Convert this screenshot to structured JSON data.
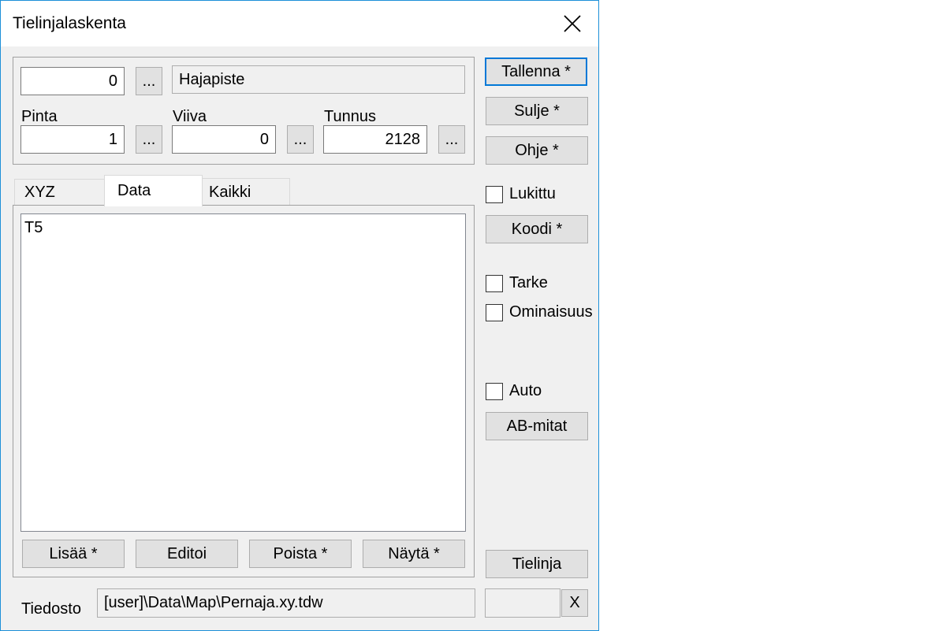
{
  "window": {
    "title": "Tielinjalaskenta"
  },
  "top_group": {
    "point_number": "0",
    "point_type": "Hajapiste",
    "pinta_label": "Pinta",
    "pinta_value": "1",
    "viiva_label": "Viiva",
    "viiva_value": "0",
    "tunnus_label": "Tunnus",
    "tunnus_value": "2128",
    "browse_label": "..."
  },
  "tabs": [
    {
      "label": "XYZ",
      "active": false
    },
    {
      "label": "Data",
      "active": true
    },
    {
      "label": "Kaikki",
      "active": false
    }
  ],
  "list": {
    "items": [
      "T5"
    ]
  },
  "list_buttons": {
    "add": "Lisää *",
    "edit": "Editoi",
    "delete": "Poista *",
    "show": "Näytä *"
  },
  "side": {
    "save": "Tallenna *",
    "close": "Sulje *",
    "help": "Ohje *",
    "locked": "Lukittu",
    "code": "Koodi *",
    "tarke": "Tarke",
    "property": "Ominaisuus",
    "auto": "Auto",
    "ab": "AB-mitat",
    "road_line": "Tielinja"
  },
  "file": {
    "label": "Tiedosto",
    "path": "[user]\\Data\\Map\\Pernaja.xy.tdw",
    "extra_value": "",
    "clear_label": "X"
  },
  "colors": {
    "window_border": "#1c8fd8",
    "default_button_border": "#0078d7",
    "dialog_bg": "#f0f0f0",
    "button_bg": "#e1e1e1"
  }
}
